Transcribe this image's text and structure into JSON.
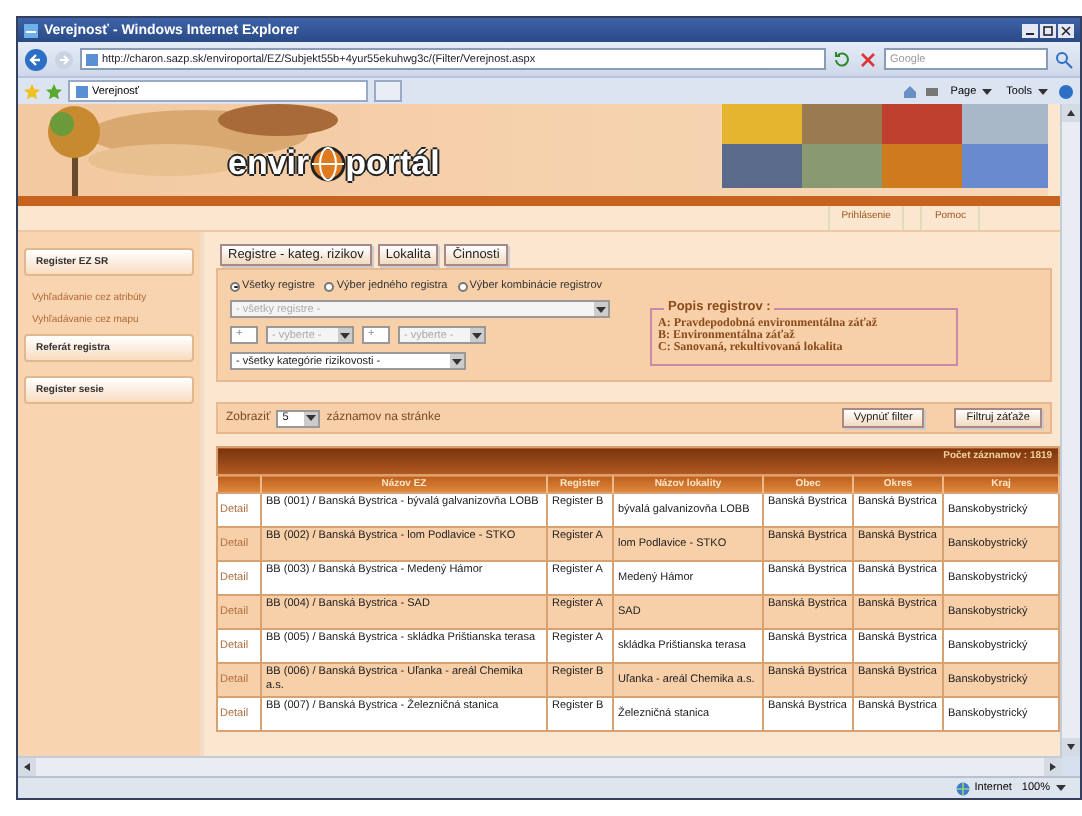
{
  "window": {
    "title": "Verejnosť - Windows Internet Explorer"
  },
  "address_bar": {
    "url": "http://charon.sazp.sk/enviroportal/EZ/Subjekt55b+4yur55ekuhwg3c/(Filter/Verejnost.aspx",
    "search_placeholder": "Google"
  },
  "tab": {
    "title": "Verejnosť"
  },
  "command_bar": {
    "items": [
      "Page",
      "Tools"
    ]
  },
  "logo": {
    "left": "envir",
    "right": "portál"
  },
  "top_links": [
    "Prihlásenie",
    "Pomoc"
  ],
  "sidebar": {
    "items": [
      {
        "label": "Register EZ SR",
        "kind": "button"
      },
      {
        "label": "Vyhľadávanie cez atribúty",
        "kind": "link"
      },
      {
        "label": "Vyhľadávanie cez mapu",
        "kind": "link"
      },
      {
        "label": "Referát registra",
        "kind": "button"
      },
      {
        "label": "Register sesie",
        "kind": "button"
      }
    ]
  },
  "main_tabs": [
    "Registre - kateg. rizikov",
    "Lokalita",
    "Činnosti"
  ],
  "filter": {
    "radios": [
      {
        "label": "Všetky registre",
        "selected": true
      },
      {
        "label": "Výber jedného registra",
        "selected": false
      },
      {
        "label": "Výber kombinácie registrov",
        "selected": false
      }
    ],
    "register_select": {
      "value": "- všetky registre -",
      "disabled": true
    },
    "combo": [
      {
        "operator": "+",
        "value": "- vyberte -",
        "disabled": true
      },
      {
        "operator": "+",
        "value": "- vyberte -",
        "disabled": true
      }
    ],
    "category_select": {
      "value": "- všetky kategórie rizikovosti -",
      "disabled": false
    },
    "legend": {
      "title": "Popis registrov :",
      "lines": [
        "A: Pravdepodobná environmentálna záťaž",
        "B: Environmentálna záťaž",
        "C: Sanovaná, rekultivovaná lokalita"
      ]
    }
  },
  "paging": {
    "label": "Zobraziť",
    "page_size": "5",
    "suffix": "záznamov na stránke",
    "buttons": [
      "Vypnúť filter",
      "Filtruj záťaže"
    ]
  },
  "table": {
    "count": "Počet záznamov : 1819",
    "columns": [
      "Názov EZ",
      "Register",
      "Názov lokality",
      "Obec",
      "Okres",
      "Kraj"
    ],
    "rows": [
      {
        "link": "Detail",
        "cells": [
          "BB (001) / Banská Bystrica - bývalá galvanizovňa LOBB",
          "Register B",
          "bývalá galvanizovňa LOBB",
          "Banská Bystrica",
          "Banská Bystrica",
          "Banskobystrický"
        ]
      },
      {
        "link": "Detail",
        "cells": [
          "BB (002) / Banská Bystrica - lom Podlavice - STKO",
          "Register A",
          "lom Podlavice - STKO",
          "Banská Bystrica",
          "Banská Bystrica",
          "Banskobystrický"
        ]
      },
      {
        "link": "Detail",
        "cells": [
          "BB (003) / Banská Bystrica - Medený Hámor",
          "Register A",
          "Medený Hámor",
          "Banská Bystrica",
          "Banská Bystrica",
          "Banskobystrický"
        ]
      },
      {
        "link": "Detail",
        "cells": [
          "BB (004) / Banská Bystrica - SAD",
          "Register A",
          "SAD",
          "Banská Bystrica",
          "Banská Bystrica",
          "Banskobystrický"
        ]
      },
      {
        "link": "Detail",
        "cells": [
          "BB (005) / Banská Bystrica - skládka Prištianska terasa",
          "Register A",
          "skládka Prištianska terasa",
          "Banská Bystrica",
          "Banská Bystrica",
          "Banskobystrický"
        ]
      },
      {
        "link": "Detail",
        "cells": [
          "BB (006) / Banská Bystrica - Uľanka - areál Chemika a.s.",
          "Register B",
          "Uľanka - areál Chemika a.s.",
          "Banská Bystrica",
          "Banská Bystrica",
          "Banskobystrický"
        ]
      },
      {
        "link": "Detail",
        "cells": [
          "BB (007) / Banská Bystrica - Železničná stanica",
          "Register B",
          "Železničná stanica",
          "Banská Bystrica",
          "Banská Bystrica",
          "Banskobystrický"
        ]
      }
    ]
  },
  "status_bar": {
    "zone": "Internet",
    "zoom": "100%"
  }
}
